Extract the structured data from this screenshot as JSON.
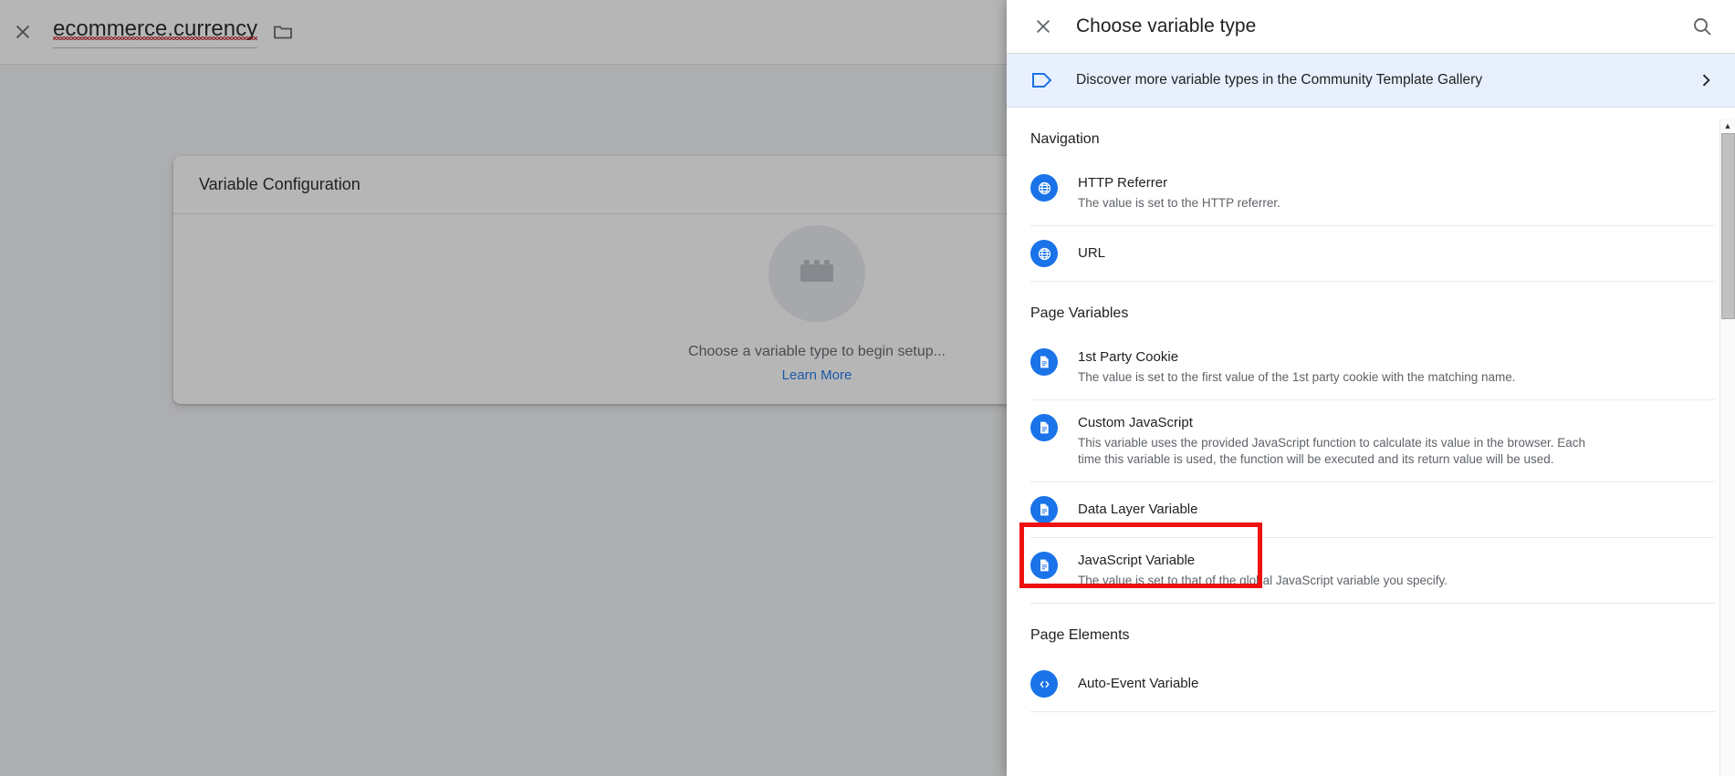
{
  "editor": {
    "close_icon": "close-icon",
    "variable_name": "ecommerce.currency",
    "folder_icon": "folder-icon",
    "card": {
      "title": "Variable Configuration",
      "empty_icon": "lego-brick-icon",
      "empty_text": "Choose a variable type to begin setup...",
      "learn_more": "Learn More"
    }
  },
  "panel": {
    "close_icon": "close-icon",
    "title": "Choose variable type",
    "search_icon": "search-icon",
    "banner": {
      "icon": "tag-icon",
      "label": "Discover more variable types in the Community Template Gallery",
      "chevron": "chevron-right-icon"
    },
    "sections": [
      {
        "title": "Navigation",
        "items": [
          {
            "icon": "globe-icon",
            "name": "HTTP Referrer",
            "desc": "The value is set to the HTTP referrer."
          },
          {
            "icon": "globe-icon",
            "name": "URL",
            "desc": ""
          }
        ]
      },
      {
        "title": "Page Variables",
        "items": [
          {
            "icon": "document-icon",
            "name": "1st Party Cookie",
            "desc": "The value is set to the first value of the 1st party cookie with the matching name."
          },
          {
            "icon": "document-icon",
            "name": "Custom JavaScript",
            "desc": "This variable uses the provided JavaScript function to calculate its value in the browser. Each time this variable is used, the function will be executed and its return value will be used."
          },
          {
            "icon": "document-icon",
            "name": "Data Layer Variable",
            "desc": ""
          },
          {
            "icon": "document-icon",
            "name": "JavaScript Variable",
            "desc": "The value is set to that of the global JavaScript variable you specify."
          }
        ]
      },
      {
        "title": "Page Elements",
        "items": [
          {
            "icon": "code-icon",
            "name": "Auto-Event Variable",
            "desc": ""
          }
        ]
      }
    ],
    "scrollbar": {
      "up_arrow": "▲"
    }
  },
  "colors": {
    "accent_blue": "#1a73e8",
    "banner_bg": "#e8f0fe",
    "highlight_red": "#ee1111",
    "text_primary": "#202124",
    "text_secondary": "#5f6368",
    "spellcheck_red": "#c62828"
  }
}
